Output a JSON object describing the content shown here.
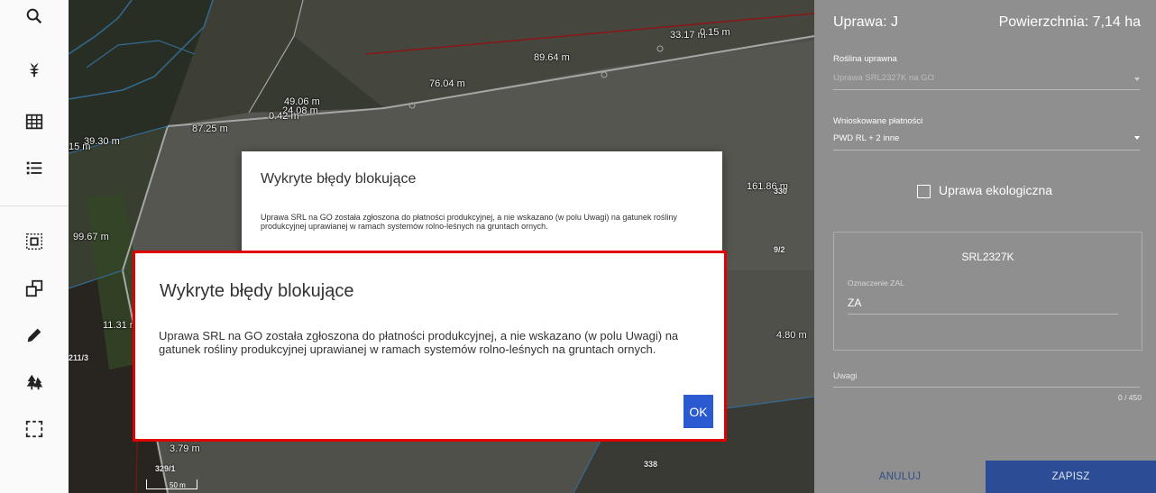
{
  "toolbar": {
    "tools": [
      "search-icon",
      "plant-icon",
      "grid-icon",
      "list-icon",
      "select-area-icon",
      "copy-shape-icon",
      "pencil-icon",
      "forest-icon",
      "rectangle-select-icon"
    ]
  },
  "map": {
    "labels": [
      "89.64 m",
      "33.17 m",
      "0.15 m",
      "76.04 m",
      "49.06 m",
      "24.08 m",
      "0.42 m",
      "87.25 m",
      "15 m",
      "39.30 m",
      "161.86 m",
      "99.67 m",
      "4.80 m",
      "11.31 m",
      "3.79 m"
    ],
    "parcels": [
      "330",
      "9/2",
      "211/3",
      "329/1",
      "338"
    ],
    "scale": "50 m"
  },
  "dialog_back": {
    "title": "Wykryte błędy blokujące",
    "message": "Uprawa SRL na GO została zgłoszona do płatności produkcyjnej, a nie wskazano (w polu Uwagi) na gatunek rośliny produkcyjnej uprawianej w ramach systemów rolno-leśnych na gruntach ornych."
  },
  "dialog_front": {
    "title": "Wykryte błędy blokujące",
    "message": "Uprawa SRL na GO została zgłoszona do płatności produkcyjnej, a nie wskazano (w polu Uwagi) na gatunek rośliny produkcyjnej uprawianej w ramach systemów rolno-leśnych na gruntach ornych.",
    "ok_label": "OK",
    "highlight_color": "#e00000",
    "button_color": "#2b59d0"
  },
  "panel": {
    "title": "Uprawa: J",
    "area": "Powierzchnia: 7,14 ha",
    "crop_label": "Roślina uprawna",
    "crop_value": "Uprawa SRL2327K na GO",
    "payments_label": "Wnioskowane płatności",
    "payments_value": "PWD RL + 2 inne",
    "eco_label": "Uprawa ekologiczna",
    "card_title": "SRL2327K",
    "zal_label": "Oznaczenie ZAL",
    "zal_value": "ZA",
    "notes_label": "Uwagi",
    "notes_counter": "0 / 450",
    "cancel_label": "ANULUJ",
    "save_label": "ZAPISZ"
  }
}
